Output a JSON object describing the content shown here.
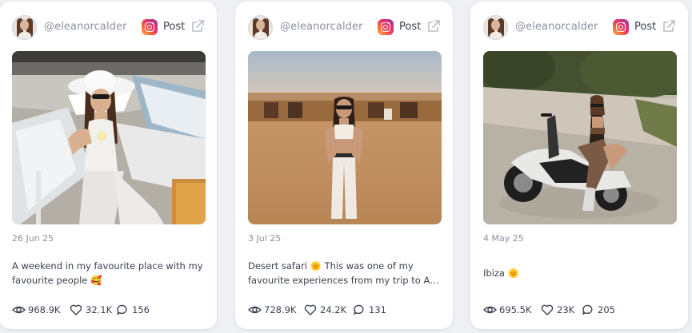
{
  "posts": [
    {
      "handle": "@eleanorcalder",
      "post_label": "Post",
      "date": "26 Jun 25",
      "caption_lines": [
        "A weekend in my favourite place with my",
        "favourite people 🥰"
      ],
      "views": "968.9K",
      "likes": "32.1K",
      "comments": "156"
    },
    {
      "handle": "@eleanorcalder",
      "post_label": "Post",
      "date": "3 Jul 25",
      "caption_lines": [
        "Desert safari 🌞 This was one of my",
        "favourite experiences from my trip to Ab..."
      ],
      "views": "728.9K",
      "likes": "24.2K",
      "comments": "131"
    },
    {
      "handle": "@eleanorcalder",
      "post_label": "Post",
      "date": "4 May 25",
      "caption_lines": [
        "Ibiza 🌞"
      ],
      "views": "695.5K",
      "likes": "23K",
      "comments": "205"
    }
  ],
  "icons": {
    "platform": "instagram-icon",
    "external": "external-link-icon",
    "views": "eye-icon",
    "likes": "heart-icon",
    "comments": "comment-icon"
  }
}
